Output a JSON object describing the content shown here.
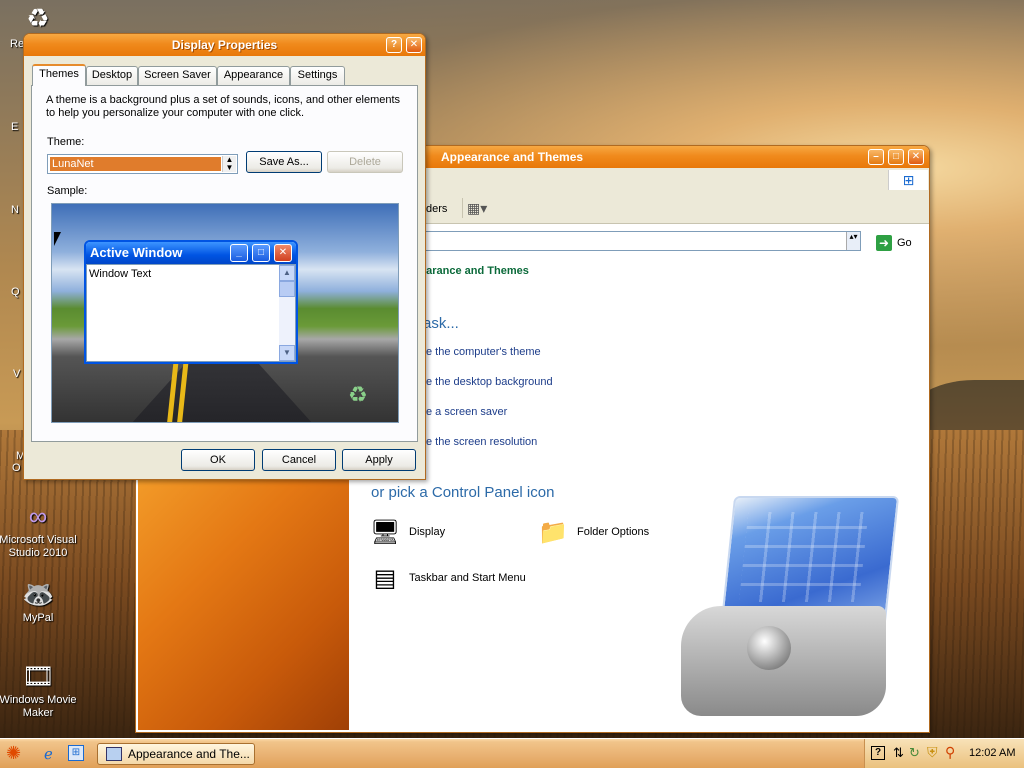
{
  "desktop": {
    "icons": [
      {
        "label": "Microsoft Visual Studio 2010",
        "glyph": "∞"
      },
      {
        "label": "MyPal",
        "glyph": "🦝"
      },
      {
        "label": "Windows Movie Maker",
        "glyph": "🎞"
      }
    ],
    "fragments": [
      "Re",
      "E",
      "N",
      "Q",
      "V",
      "M",
      "O"
    ]
  },
  "display_properties": {
    "title": "Display Properties",
    "help_btn": "?",
    "close_btn": "✕",
    "tabs": [
      "Themes",
      "Desktop",
      "Screen Saver",
      "Appearance",
      "Settings"
    ],
    "description": "A theme is a background plus a set of sounds, icons, and other elements to help you personalize your computer with one click.",
    "theme_label": "Theme:",
    "theme_value": "LunaNet",
    "save_as": "Save As...",
    "delete": "Delete",
    "sample_label": "Sample:",
    "sample_window": {
      "title": "Active Window",
      "text": "Window Text"
    },
    "ok": "OK",
    "cancel": "Cancel",
    "apply": "Apply"
  },
  "appearance_themes": {
    "title": "Appearance and Themes",
    "toolbar_frag": "ders",
    "address_go": "Go",
    "breadcrumb": "earance and Themes",
    "pick_task": "ask...",
    "tasks": [
      "e the computer's theme",
      "e the desktop background",
      "e a screen saver",
      "e the screen resolution"
    ],
    "pick_icon": "or pick a Control Panel icon",
    "icons": [
      {
        "label": "Display",
        "icon": "display-icon"
      },
      {
        "label": "Folder Options",
        "icon": "folder-options-icon"
      },
      {
        "label": "Taskbar and Start Menu",
        "icon": "taskbar-icon"
      }
    ]
  },
  "taskbar": {
    "active_item": "Appearance and The...",
    "clock": "12:02 AM"
  }
}
